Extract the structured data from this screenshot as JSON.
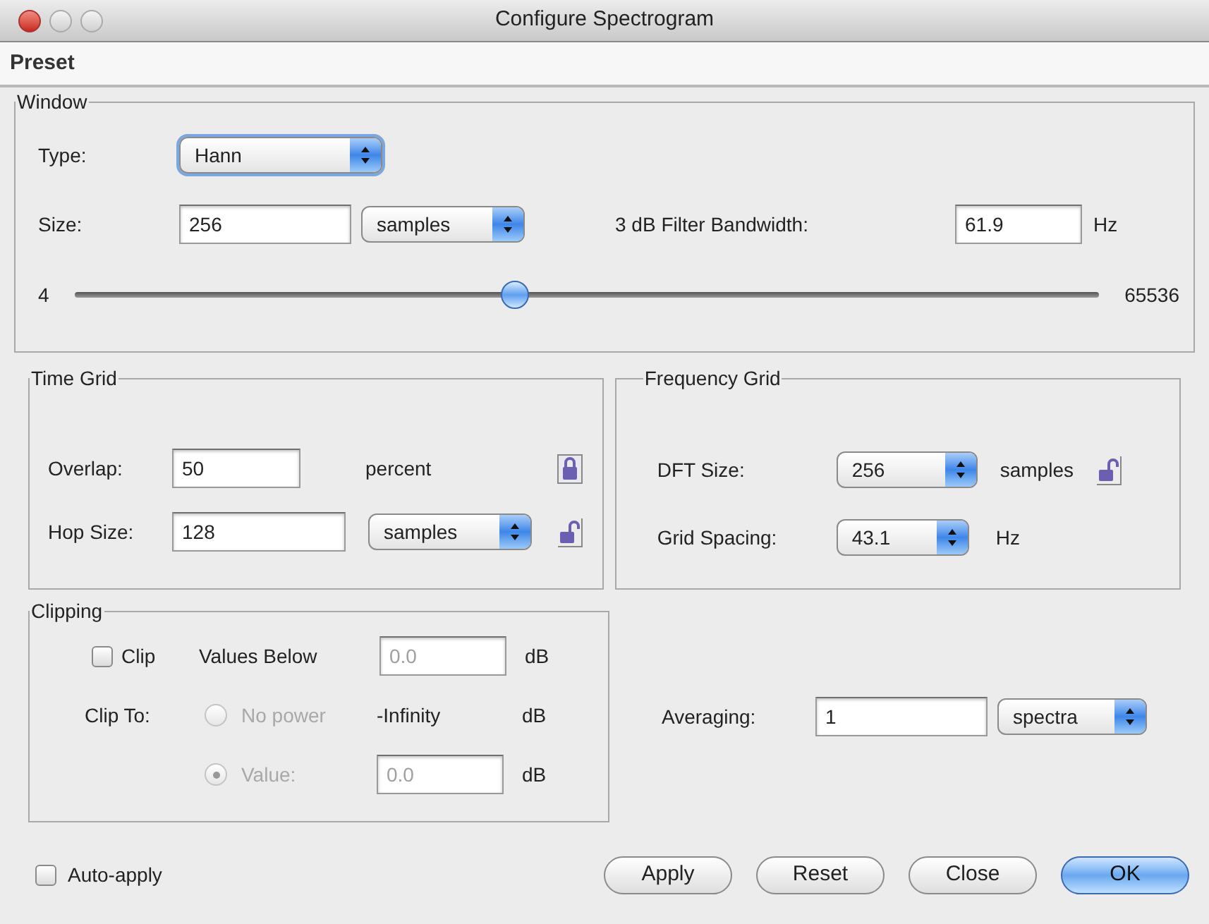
{
  "window": {
    "title": "Configure Spectrogram"
  },
  "menu": [
    {
      "label": "Preset"
    }
  ],
  "window_group": {
    "title": "Window",
    "type": {
      "label": "Type:",
      "value": "Hann"
    },
    "size": {
      "label": "Size:",
      "value": "256",
      "unit": "samples"
    },
    "bandwidth": {
      "label": "3 dB Filter Bandwidth:",
      "value": "61.9",
      "unit": "Hz"
    },
    "slider": {
      "min": "4",
      "max": "65536",
      "level": 0.43
    }
  },
  "time_grid": {
    "title": "Time Grid",
    "overlap": {
      "label": "Overlap:",
      "value": "50",
      "unit": "percent",
      "locked": true
    },
    "hop_size": {
      "label": "Hop Size:",
      "value": "128",
      "unit": "samples",
      "locked": false
    }
  },
  "frequency_grid": {
    "title": "Frequency Grid",
    "dft_size": {
      "label": "DFT Size:",
      "value": "256",
      "unit": "samples",
      "locked": false
    },
    "grid_spacing": {
      "label": "Grid Spacing:",
      "value": "43.1",
      "unit": "Hz"
    }
  },
  "clipping": {
    "title": "Clipping",
    "clip": {
      "label": "Clip",
      "checked": false
    },
    "values_below": {
      "label": "Values Below",
      "value": "0.0",
      "unit": "dB",
      "disabled": true
    },
    "clip_to": {
      "label": "Clip To:",
      "options": [
        {
          "kind": "text",
          "label": "No power",
          "value": "-Infinity",
          "unit": "dB",
          "selected": false,
          "disabled": true
        },
        {
          "kind": "field",
          "label": "Value:",
          "value": "0.0",
          "unit": "dB",
          "selected": true,
          "disabled": true
        }
      ]
    }
  },
  "averaging": {
    "label": "Averaging:",
    "value": "1",
    "unit": "spectra"
  },
  "auto_apply": {
    "label": "Auto-apply",
    "checked": false
  },
  "buttons": [
    {
      "label": "Apply",
      "default": false
    },
    {
      "label": "Reset",
      "default": false
    },
    {
      "label": "Close",
      "default": false
    },
    {
      "label": "OK",
      "default": true
    }
  ]
}
